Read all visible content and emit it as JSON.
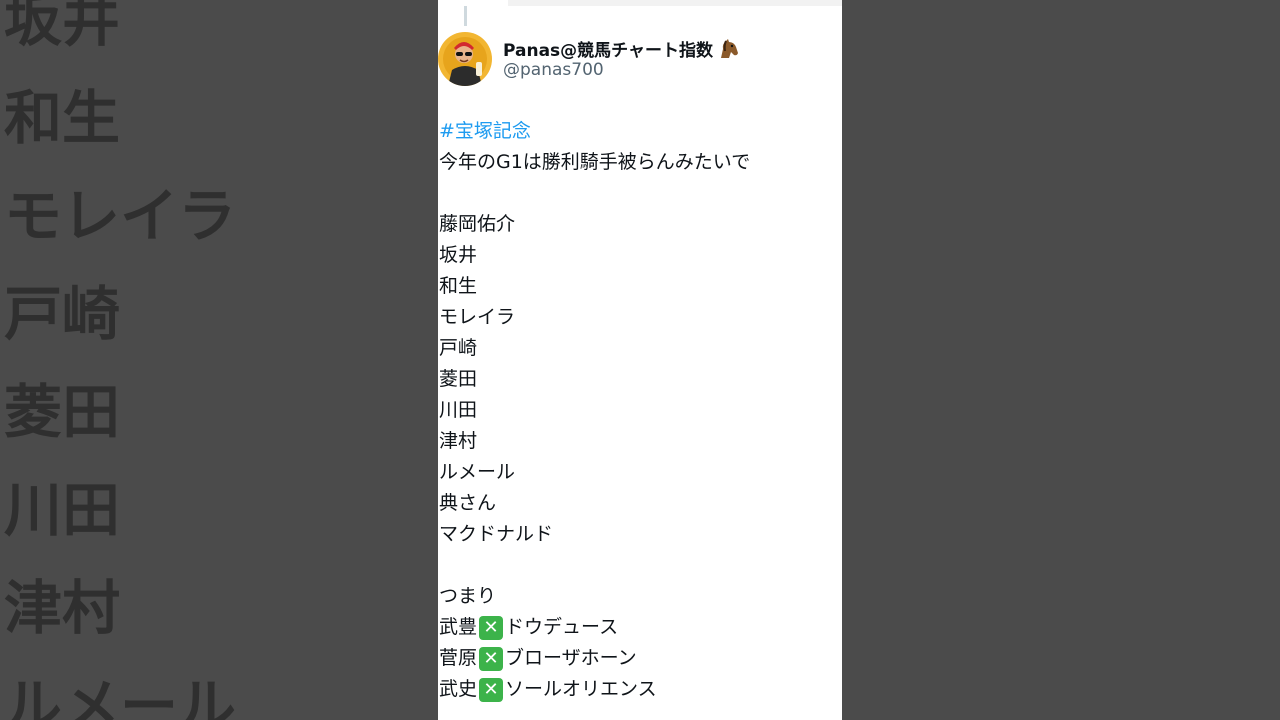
{
  "background_text": [
    "坂井",
    "和生",
    "モレイラ",
    "戸崎",
    "菱田",
    "川田",
    "津村",
    "ルメール"
  ],
  "tweet": {
    "display_name": "Panas@競馬チャート指数",
    "handle": "@panas700",
    "hashtag": "#宝塚記念",
    "intro": "今年のG1は勝利騎手被らんみたいで",
    "jockeys": [
      "藤岡佑介",
      "坂井",
      "和生",
      "モレイラ",
      "戸崎",
      "菱田",
      "川田",
      "津村",
      "ルメール",
      "典さん",
      "マクドナルド"
    ],
    "conclusion": "つまり",
    "pairs": [
      {
        "jockey": "武豊",
        "horse": "ドウデュース"
      },
      {
        "jockey": "菅原",
        "horse": "ブローザホーン"
      },
      {
        "jockey": "武史",
        "horse": "ソールオリエンス"
      }
    ]
  },
  "colors": {
    "hashtag": "#1d9bf0",
    "emoji_green": "#3cb34a",
    "background": "#4b4b4b"
  }
}
